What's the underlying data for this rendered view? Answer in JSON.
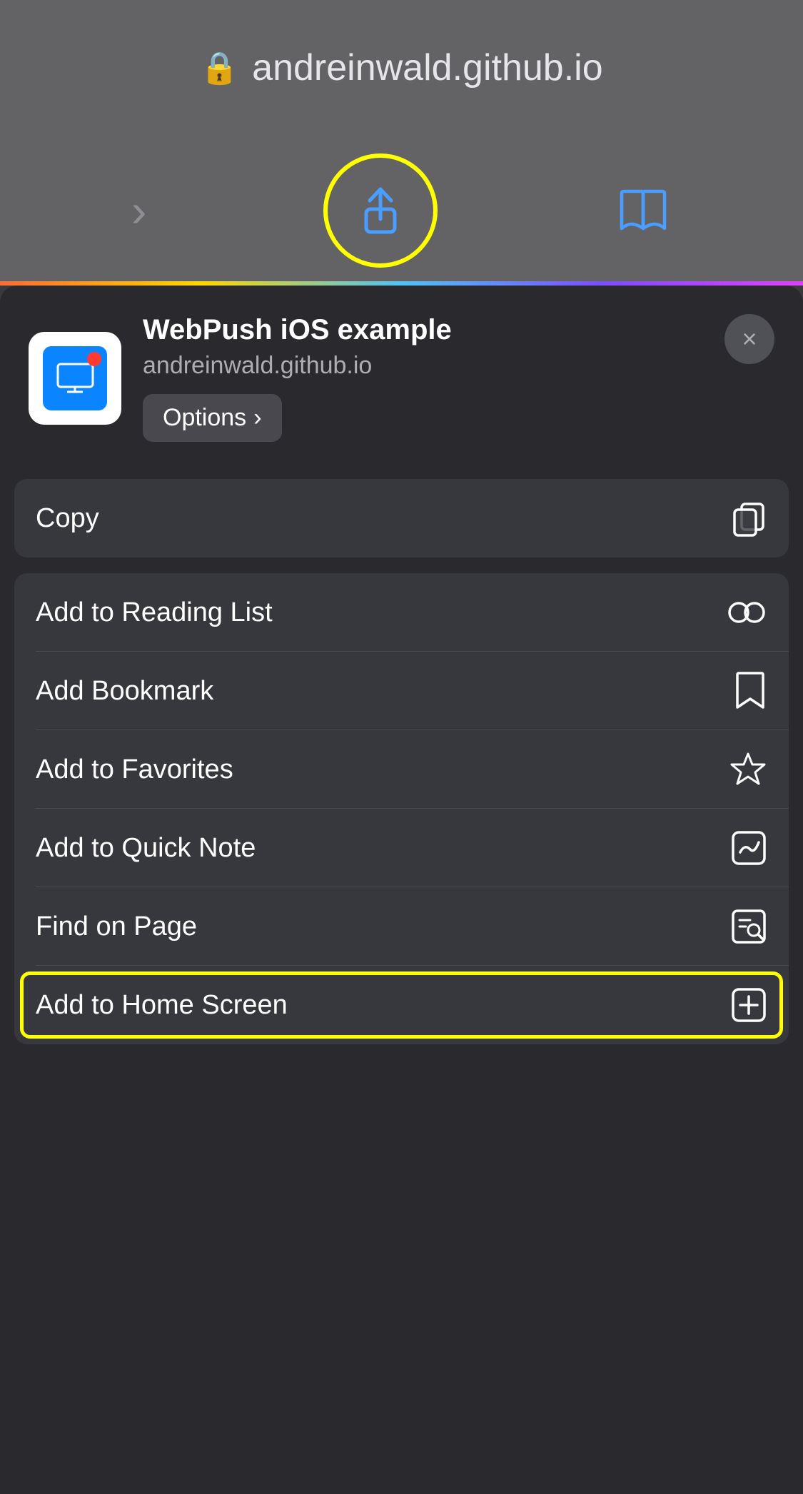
{
  "browser": {
    "url": "andreinwald.github.io",
    "lock_icon": "🔒"
  },
  "toolbar": {
    "forward_arrow": "›",
    "book_icon": "📖"
  },
  "share_sheet": {
    "app_title": "WebPush iOS example",
    "app_url": "andreinwald.github.io",
    "options_label": "Options",
    "options_arrow": "›",
    "close_label": "×",
    "sections": [
      {
        "id": "copy-section",
        "items": [
          {
            "label": "Copy",
            "icon_name": "copy-icon"
          }
        ]
      },
      {
        "id": "actions-section",
        "items": [
          {
            "label": "Add to Reading List",
            "icon_name": "reading-list-icon"
          },
          {
            "label": "Add Bookmark",
            "icon_name": "bookmark-icon"
          },
          {
            "label": "Add to Favorites",
            "icon_name": "favorites-icon"
          },
          {
            "label": "Add to Quick Note",
            "icon_name": "quick-note-icon"
          },
          {
            "label": "Find on Page",
            "icon_name": "find-on-page-icon"
          },
          {
            "label": "Add to Home Screen",
            "icon_name": "add-home-icon"
          }
        ]
      }
    ]
  }
}
